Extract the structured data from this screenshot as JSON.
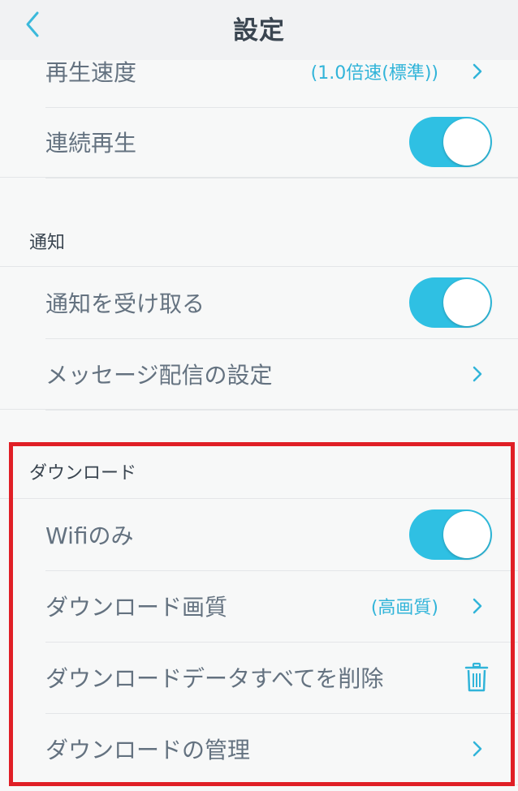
{
  "nav": {
    "title": "設定",
    "back_icon": "chevron-left-icon"
  },
  "playback": {
    "speed_label": "再生速度",
    "speed_value": "(1.0倍速(標準))",
    "continuous_label": "連続再生",
    "continuous_on": true
  },
  "notifications": {
    "header": "通知",
    "receive_label": "通知を受け取る",
    "receive_on": true,
    "message_settings_label": "メッセージ配信の設定"
  },
  "download": {
    "header": "ダウンロード",
    "wifi_only_label": "Wifiのみ",
    "wifi_only_on": true,
    "quality_label": "ダウンロード画質",
    "quality_value": "(高画質)",
    "delete_all_label": "ダウンロードデータすべてを削除",
    "manage_label": "ダウンロードの管理"
  },
  "colors": {
    "accent": "#31b4d9",
    "toggle_on": "#2fc0e3",
    "highlight_border": "#e01f26",
    "background": "#f7f8f8"
  }
}
